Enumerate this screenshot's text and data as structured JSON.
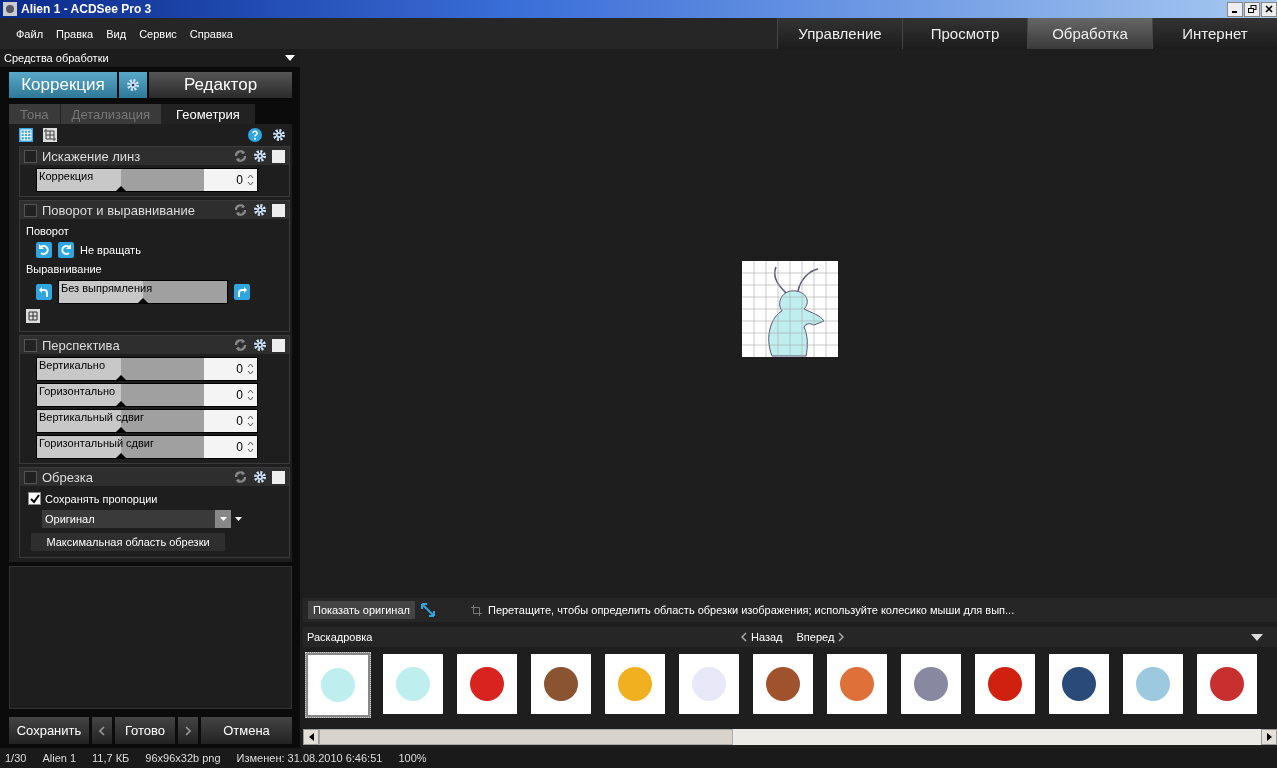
{
  "window": {
    "title": "Alien 1 - ACDSee Pro 3"
  },
  "menu": [
    "Файл",
    "Правка",
    "Вид",
    "Сервис",
    "Справка"
  ],
  "modes": [
    {
      "label": "Управление",
      "selected": false
    },
    {
      "label": "Просмотр",
      "selected": false
    },
    {
      "label": "Обработка",
      "selected": true
    },
    {
      "label": "Интернет",
      "selected": false
    }
  ],
  "panel": {
    "title": "Средства обработки",
    "modes": [
      {
        "label": "Коррекция",
        "selected": true
      },
      {
        "label": "Редактор",
        "selected": false
      }
    ],
    "tabs": [
      {
        "label": "Тона",
        "selected": false
      },
      {
        "label": "Детализация",
        "selected": false
      },
      {
        "label": "Геометрия",
        "selected": true
      }
    ],
    "sections": [
      {
        "kind": "sliders",
        "title": "Искажение линз",
        "checked": false,
        "sliders": [
          {
            "label": "Коррекция",
            "level": 0.5,
            "value": "0"
          }
        ]
      },
      {
        "kind": "rotate",
        "title": "Поворот и выравнивание",
        "checked": false,
        "rotate_label": "Поворот",
        "rotate_value": "Не вращать",
        "straighten_label": "Выравнивание",
        "straighten": {
          "label": "Без выпрямления",
          "level": 0.5
        }
      },
      {
        "kind": "sliders",
        "title": "Перспектива",
        "checked": false,
        "sliders": [
          {
            "label": "Вертикально",
            "level": 0.5,
            "value": "0"
          },
          {
            "label": "Горизонтально",
            "level": 0.5,
            "value": "0"
          },
          {
            "label": "Вертикальный сдвиг",
            "level": 0.5,
            "value": "0"
          },
          {
            "label": "Горизонтальный сдвиг",
            "level": 0.5,
            "value": "0"
          }
        ]
      },
      {
        "kind": "crop",
        "title": "Обрезка",
        "checked": false,
        "keep_ratio": {
          "label": "Сохранять пропорции",
          "checked": true
        },
        "ratio": "Оригинал",
        "button": "Максимальная область обрезки"
      }
    ],
    "footer": {
      "save": "Сохранить",
      "done": "Готово",
      "cancel": "Отмена"
    }
  },
  "preview": {
    "show_original": "Показать оригинал",
    "hint": "Перетащите, чтобы определить область обрезки изображения; используйте колесико мыши для вып..."
  },
  "filmstrip": {
    "title": "Раскадровка",
    "back": "Назад",
    "forward": "Вперед",
    "thumbnails": [
      {
        "selected": true,
        "color": "#bfeeee"
      },
      {
        "selected": false,
        "color": "#bfeeee"
      },
      {
        "selected": false,
        "color": "#d8231e"
      },
      {
        "selected": false,
        "color": "#8a5433"
      },
      {
        "selected": false,
        "color": "#f0b020"
      },
      {
        "selected": false,
        "color": "#e8e8f8"
      },
      {
        "selected": false,
        "color": "#a0522d"
      },
      {
        "selected": false,
        "color": "#e0703a"
      },
      {
        "selected": false,
        "color": "#8888a0"
      },
      {
        "selected": false,
        "color": "#d02010"
      },
      {
        "selected": false,
        "color": "#2a4a7a"
      },
      {
        "selected": false,
        "color": "#9cc8e0"
      },
      {
        "selected": false,
        "color": "#c83030"
      }
    ]
  },
  "status_bar": [
    "1/30",
    "Alien 1",
    "11,7 КБ",
    "96x96x32b png",
    "Изменен: 31.08.2010 6:46:51",
    "100%"
  ]
}
